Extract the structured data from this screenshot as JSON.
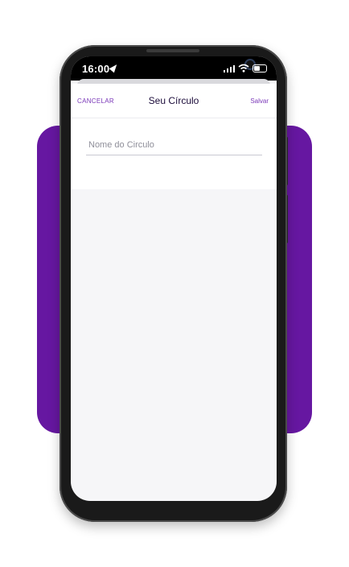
{
  "status_bar": {
    "time": "16:00",
    "icons": [
      "location-arrow-icon",
      "cellular-signal-icon",
      "wifi-icon",
      "battery-icon"
    ]
  },
  "nav": {
    "cancel_label": "CANCELAR",
    "title": "Seu Círculo",
    "save_label": "Salvar"
  },
  "form": {
    "name_placeholder": "Nome do Circulo",
    "name_value": ""
  },
  "colors": {
    "brand_purple": "#6617a1",
    "accent": "#7a37b8",
    "title": "#1b0b3a"
  }
}
